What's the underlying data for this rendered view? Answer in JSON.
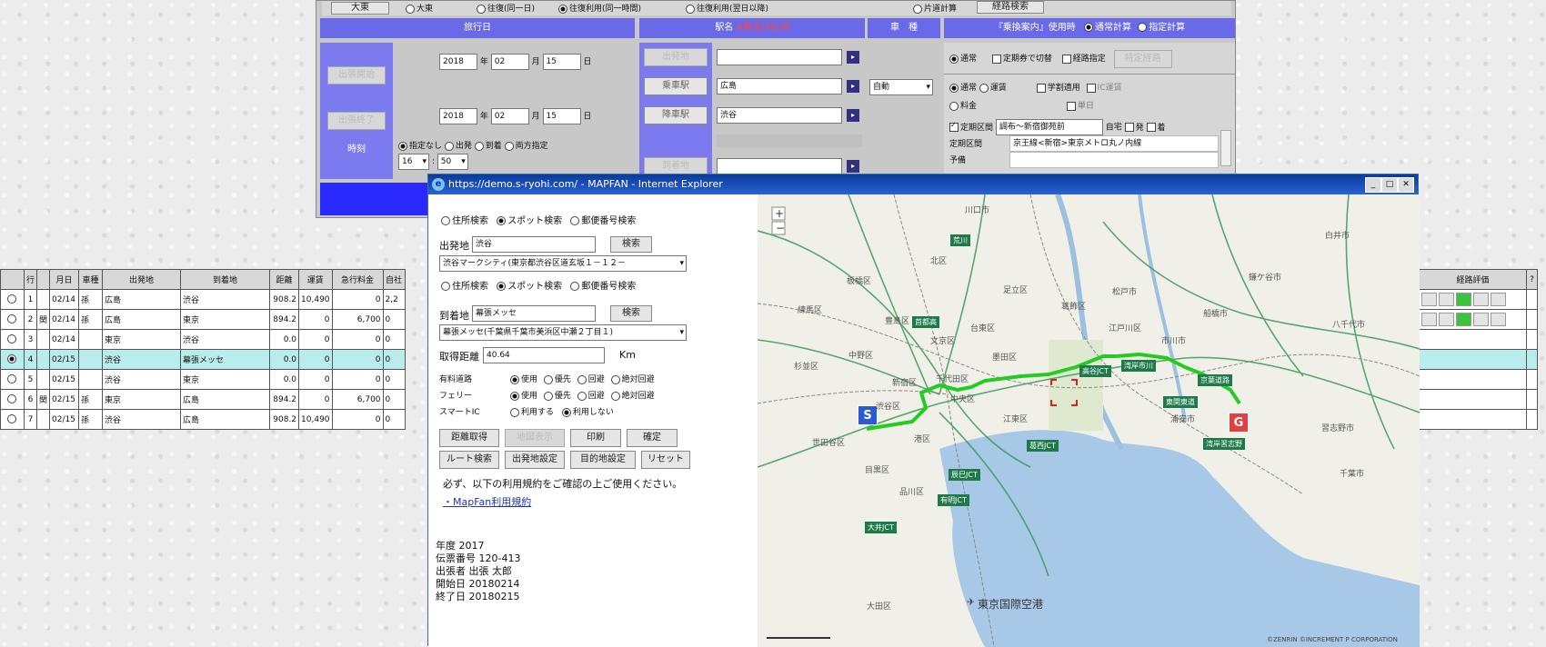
{
  "top_form": {
    "row0": {
      "opt1": "大東",
      "opt2": "往復(同一日)",
      "opt3": "往復利用(同一時間)",
      "opt4": "往復利用(翌日以降)",
      "opt5": "片道計算",
      "btn": "経路検索"
    },
    "header_travel_date": "旅行日",
    "header_station": "駅名",
    "header_station_note": "※駅名は必須",
    "header_vehicle": "車　種",
    "header_route": "『乗換案内』使用時",
    "route_mode_normal": "通常計算",
    "route_mode_fixed": "指定計算",
    "btn_start": "出張開始",
    "btn_end": "出張終了",
    "time_label": "時刻",
    "date1": {
      "year": "2018",
      "year_unit": "年",
      "month": "02",
      "month_unit": "月",
      "day": "15",
      "day_unit": "日"
    },
    "date2": {
      "year": "2018",
      "year_unit": "年",
      "month": "02",
      "month_unit": "月",
      "day": "15",
      "day_unit": "日"
    },
    "time_options": [
      "指定なし",
      "出発",
      "到着",
      "両方指定"
    ],
    "hour": "16",
    "minute": "50",
    "stations": [
      {
        "btn": "出発地",
        "value": ""
      },
      {
        "btn": "乗車駅",
        "value": "広島"
      },
      {
        "btn": "降車駅",
        "value": "渋谷"
      },
      {
        "btn": "",
        "value": ""
      },
      {
        "btn": "到着地",
        "value": ""
      }
    ],
    "vehicle_value": "自動",
    "route_opts1": {
      "a": "通常",
      "b": "定期券で切替",
      "c": "経路指定",
      "btn": "特定経路"
    },
    "route_opts2": {
      "a": "通常",
      "b": "運賃",
      "c": "学割適用",
      "d": "IC運賃",
      "e": "料金",
      "f": "単日"
    },
    "commuter": {
      "label": "定期区間",
      "value": "調布～新宿御苑前",
      "self": "自宅",
      "dep": "発",
      "arr": "着"
    },
    "commuter_section": {
      "label": "定期区間",
      "value": "京王線<新宿>東京メトロ丸ノ内線"
    },
    "reserve_label": "予備"
  },
  "table": {
    "headers": [
      "",
      "行",
      "月日",
      "車種",
      "出発地",
      "到着地",
      "距離",
      "運賃",
      "急行料金",
      "自社"
    ],
    "rows": [
      {
        "sel": false,
        "no": "1",
        "flag": "",
        "date": "02/14",
        "type": "孫",
        "from": "広島",
        "to": "渋谷",
        "dist": "908.2",
        "fare": "10,490",
        "exp": "0",
        "extra": "2,2"
      },
      {
        "sel": false,
        "no": "2",
        "flag": "関",
        "date": "02/14",
        "type": "孫",
        "from": "広島",
        "to": "東京",
        "dist": "894.2",
        "fare": "0",
        "exp": "6,700",
        "extra": "0"
      },
      {
        "sel": false,
        "no": "3",
        "flag": "",
        "date": "02/14",
        "type": "",
        "from": "東京",
        "to": "渋谷",
        "dist": "0.0",
        "fare": "0",
        "exp": "0",
        "extra": "0"
      },
      {
        "sel": true,
        "no": "4",
        "flag": "",
        "date": "02/15",
        "type": "",
        "from": "渋谷",
        "to": "幕張メッセ",
        "dist": "0.0",
        "fare": "0",
        "exp": "0",
        "extra": "0"
      },
      {
        "sel": false,
        "no": "5",
        "flag": "",
        "date": "02/15",
        "type": "",
        "from": "渋谷",
        "to": "東京",
        "dist": "0.0",
        "fare": "0",
        "exp": "0",
        "extra": "0"
      },
      {
        "sel": false,
        "no": "6",
        "flag": "関",
        "date": "02/15",
        "type": "孫",
        "from": "東京",
        "to": "広島",
        "dist": "894.2",
        "fare": "0",
        "exp": "6,700",
        "extra": "0"
      },
      {
        "sel": false,
        "no": "7",
        "flag": "",
        "date": "02/15",
        "type": "孫",
        "from": "渋谷",
        "to": "広島",
        "dist": "908.2",
        "fare": "10,490",
        "exp": "0",
        "extra": "0"
      }
    ],
    "right_header": "経路評価",
    "right_header2": "?"
  },
  "ie": {
    "title": "https://demo.s-ryohi.com/ - MAPFAN - Internet Explorer",
    "search_opts": [
      "住所検索",
      "スポット検索",
      "郵便番号検索"
    ],
    "origin_label": "出発地",
    "origin_value": "渋谷",
    "origin_search_btn": "検索",
    "origin_select": "渋谷マークシティ(東京都渋谷区道玄坂１－１２－",
    "dest_label": "到着地",
    "dest_value": "幕張メッセ",
    "dest_search_btn": "検索",
    "dest_select": "幕張メッセ(千葉県千葉市美浜区中瀬２丁目１)",
    "distance_label": "取得距離",
    "distance_value": "40.64",
    "distance_unit": "Km",
    "toll_label": "有料道路",
    "ferry_label": "フェリー",
    "smart_label": "スマートIC",
    "road_opts": [
      "使用",
      "優先",
      "回避",
      "絶対回避"
    ],
    "smart_opts": [
      "利用する",
      "利用しない"
    ],
    "buttons_row1": [
      "距離取得",
      "地図表示",
      "印刷",
      "確定"
    ],
    "buttons_row2": [
      "ルート検索",
      "出発地設定",
      "目的地設定",
      "リセット"
    ],
    "notice": "必ず、以下の利用規約をご確認の上ご使用ください。",
    "terms_link": "・MapFan利用規約",
    "info": [
      {
        "k": "年度",
        "v": "2017"
      },
      {
        "k": "伝票番号",
        "v": "120-413"
      },
      {
        "k": "出張者",
        "v": "出張 太郎"
      },
      {
        "k": "開始日",
        "v": "20180214"
      },
      {
        "k": "終了日",
        "v": "20180215"
      }
    ]
  },
  "map": {
    "cities": [
      "川口市",
      "松戸市",
      "市川市",
      "船橋市",
      "八千代市",
      "鎌ケ谷市",
      "白井市",
      "足立区",
      "葛飾区",
      "江戸川区",
      "墨田区",
      "江東区",
      "豊島区",
      "文京区",
      "台東区",
      "北区",
      "板橋区",
      "練馬区",
      "中野区",
      "杉並区",
      "世田谷区",
      "目黒区",
      "品川区",
      "大田区",
      "港区",
      "中央区",
      "千代田区",
      "新宿区",
      "渋谷区",
      "浦安市",
      "習志野市",
      "千葉市"
    ],
    "labels": [
      "荒川",
      "首都高",
      "京葉道路",
      "湾岸習志野",
      "東関東道",
      "葛西JCT",
      "辰巳JCT",
      "有明JCT",
      "大井JCT",
      "高谷JCT",
      "湾岸市川"
    ],
    "airport": "東京国際空港",
    "start_marker": "S",
    "goal_marker": "G",
    "copyright": "©ZENRIN ©INCREMENT P CORPORATION",
    "route_color": "#22cc22"
  }
}
